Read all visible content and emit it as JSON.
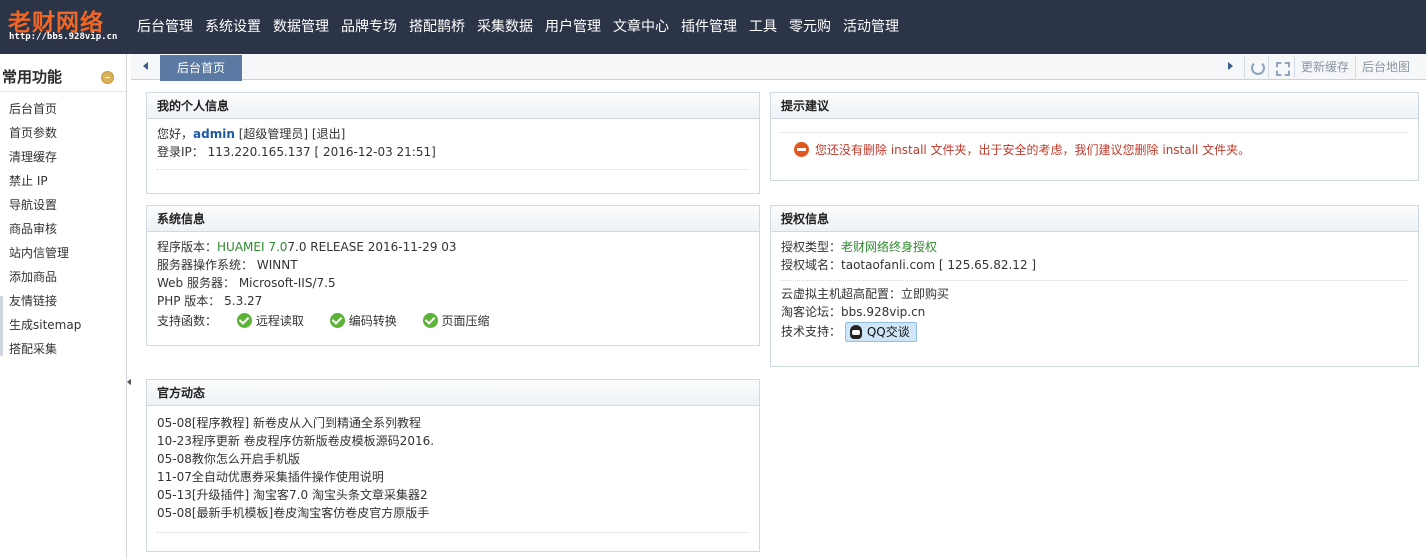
{
  "brand": {
    "name": "老财网络",
    "url": "http://bbs.928vip.cn"
  },
  "nav": [
    "后台管理",
    "系统设置",
    "数据管理",
    "品牌专场",
    "搭配鹊桥",
    "采集数据",
    "用户管理",
    "文章中心",
    "插件管理",
    "工具",
    "零元购",
    "活动管理"
  ],
  "sidebar": {
    "title": "常用功能",
    "items": [
      "后台首页",
      "首页参数",
      "清理缓存",
      "禁止 IP",
      "导航设置",
      "商品审核",
      "站内信管理",
      "添加商品",
      "友情链接",
      "生成sitemap",
      "搭配采集"
    ]
  },
  "tabs": {
    "active": "后台首页",
    "refresh_cache": "更新缓存",
    "sitemap": "后台地图"
  },
  "personal": {
    "title": "我的个人信息",
    "greeting": "您好，",
    "username": "admin",
    "role": "[超级管理员]",
    "logout": "[退出]",
    "ip_label": "登录IP：",
    "ip_value": "113.220.165.137 [ 2016-12-03 21:51]"
  },
  "advice": {
    "title": "提示建议",
    "message": "您还没有删除 install 文件夹，出于安全的考虑，我们建议您删除 install 文件夹。"
  },
  "system": {
    "title": "系统信息",
    "version_label": "程序版本：",
    "version_name": "HUAMEI 7.0",
    "version_rest": "7.0 RELEASE 2016-11-29 03",
    "os_label": "服务器操作系统：",
    "os_value": "WINNT",
    "web_label": "Web 服务器：",
    "web_value": "Microsoft-IIS/7.5",
    "php_label": "PHP 版本：",
    "php_value": "5.3.27",
    "funcs_label": "支持函数：",
    "funcs": [
      "远程读取",
      "编码转换",
      "页面压缩"
    ]
  },
  "license": {
    "title": "授权信息",
    "type_label": "授权类型：",
    "type_value": "老财网络终身授权",
    "domain_label": "授权域名：",
    "domain_value": "taotaofanli.com [ 125.65.82.12 ]",
    "cloud_label": "云虚拟主机超高配置：",
    "cloud_value": "立即购买",
    "forum_label": "淘客论坛：",
    "forum_value": "bbs.928vip.cn",
    "support_label": "技术支持：",
    "qq_label": "QQ交谈"
  },
  "news": {
    "title": "官方动态",
    "items": [
      "05-08[程序教程] 新卷皮从入门到精通全系列教程",
      "10-23程序更新 卷皮程序仿新版卷皮模板源码2016.",
      "05-08教你怎么开启手机版",
      "11-07全自动优惠券采集插件操作使用说明",
      "05-13[升级插件] 淘宝客7.0 淘宝头条文章采集器2",
      "05-08[最新手机模板]卷皮淘宝客仿卷皮官方原版手"
    ]
  }
}
